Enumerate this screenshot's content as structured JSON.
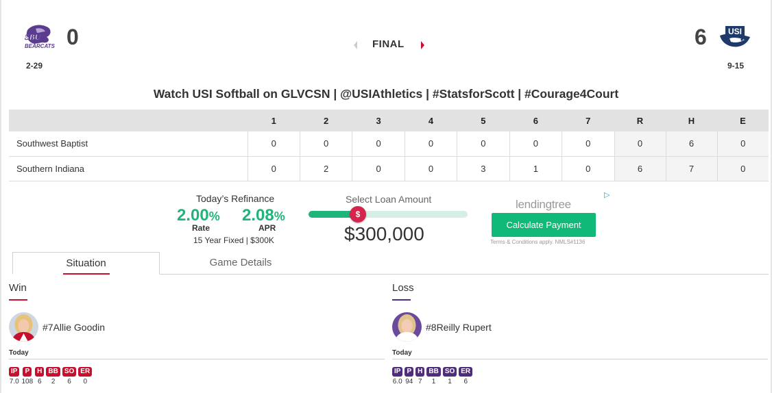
{
  "header": {
    "away": {
      "logo_text": "SBU BEARCATS",
      "score": "0",
      "record": "2-29"
    },
    "home": {
      "logo_text": "USI",
      "score": "6",
      "record": "9-15"
    },
    "status": "FINAL"
  },
  "banner": "Watch USI Softball on GLVCSN | @USIAthletics | #StatsforScott | #Courage4Court",
  "linescore": {
    "columns": [
      "1",
      "2",
      "3",
      "4",
      "5",
      "6",
      "7",
      "R",
      "H",
      "E"
    ],
    "rows": [
      {
        "team": "Southwest Baptist",
        "innings": [
          "0",
          "0",
          "0",
          "0",
          "0",
          "0",
          "0"
        ],
        "totals": [
          "0",
          "6",
          "0"
        ]
      },
      {
        "team": "Southern Indiana",
        "innings": [
          "0",
          "2",
          "0",
          "0",
          "3",
          "1",
          "0"
        ],
        "totals": [
          "6",
          "7",
          "0"
        ]
      }
    ]
  },
  "ad": {
    "title": "Today’s Refinance",
    "rate_value": "2.00",
    "rate_suffix": "%",
    "rate_label": "Rate",
    "apr_value": "2.08",
    "apr_suffix": "%",
    "apr_label": "APR",
    "term": "15 Year Fixed | $300K",
    "loan_label": "Select Loan Amount",
    "thumb_icon": "$",
    "amount": "$300,000",
    "slider_fraction": 0.31,
    "brand": "lendingtree",
    "adchoice_icon": "▷",
    "button": "Calculate Payment",
    "disclaimer": "Terms & Conditions apply. NMLS#1136"
  },
  "tabs": {
    "situation": "Situation",
    "details": "Game Details"
  },
  "pitchers": {
    "win": {
      "title": "Win",
      "name": "#7Allie Goodin",
      "today": "Today",
      "stats": [
        {
          "label": "IP",
          "value": "7.0"
        },
        {
          "label": "P",
          "value": "108"
        },
        {
          "label": "H",
          "value": "6"
        },
        {
          "label": "BB",
          "value": "2"
        },
        {
          "label": "SO",
          "value": "6"
        },
        {
          "label": "ER",
          "value": "0"
        }
      ]
    },
    "loss": {
      "title": "Loss",
      "name": "#8Reilly Rupert",
      "today": "Today",
      "stats": [
        {
          "label": "IP",
          "value": "6.0"
        },
        {
          "label": "P",
          "value": "94"
        },
        {
          "label": "H",
          "value": "7"
        },
        {
          "label": "BB",
          "value": "1"
        },
        {
          "label": "SO",
          "value": "1"
        },
        {
          "label": "ER",
          "value": "6"
        }
      ]
    }
  },
  "colors": {
    "usi_red": "#c8102e",
    "sbu_purple": "#4f2c7d",
    "ad_green": "#1fb57a"
  }
}
